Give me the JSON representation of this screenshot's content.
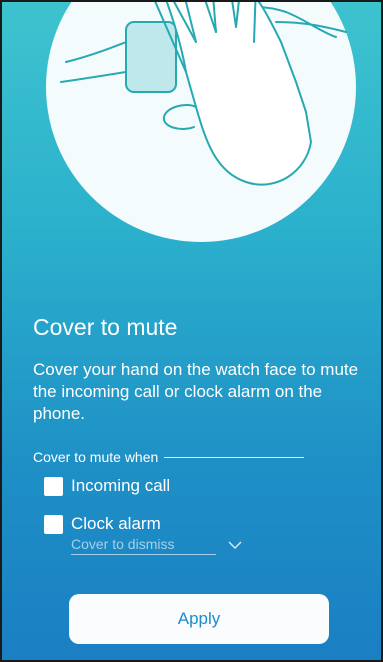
{
  "hero": {
    "icon": "hand-covering-watch-illustration"
  },
  "title": "Cover to mute",
  "description": "Cover your hand on the watch face to mute the incoming call or clock alarm on the phone.",
  "section_label": "Cover to mute when",
  "options": [
    {
      "label": "Incoming call",
      "checked": false
    },
    {
      "label": "Clock alarm",
      "checked": false
    }
  ],
  "dropdown": {
    "value": "Cover to dismiss",
    "icon": "chevron-down-icon"
  },
  "apply_label": "Apply"
}
